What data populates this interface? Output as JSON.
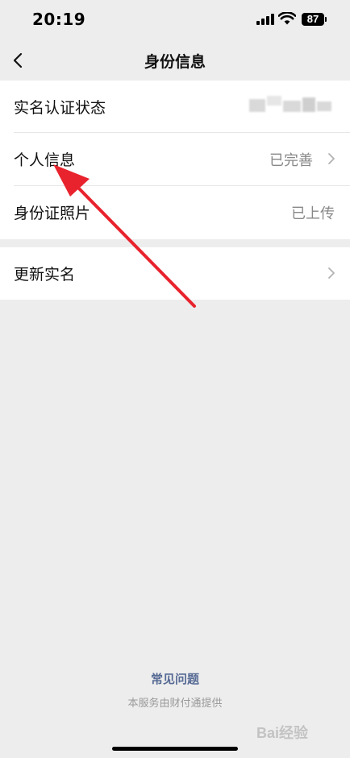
{
  "status_bar": {
    "time": "20:19",
    "battery": "87"
  },
  "nav": {
    "title": "身份信息",
    "back_icon": "chevron-left-icon"
  },
  "rows": [
    {
      "label": "实名认证状态",
      "value": "",
      "chevron": false
    },
    {
      "label": "个人信息",
      "value": "已完善",
      "chevron": true
    },
    {
      "label": "身份证照片",
      "value": "已上传",
      "chevron": false
    }
  ],
  "update_row": {
    "label": "更新实名",
    "chevron": true
  },
  "footer": {
    "faq": "常见问题",
    "provider": "本服务由财付通提供"
  },
  "watermark": "Bai经验",
  "colors": {
    "background": "#ededed",
    "link": "#576b95",
    "annotation_arrow": "#e8232d"
  }
}
